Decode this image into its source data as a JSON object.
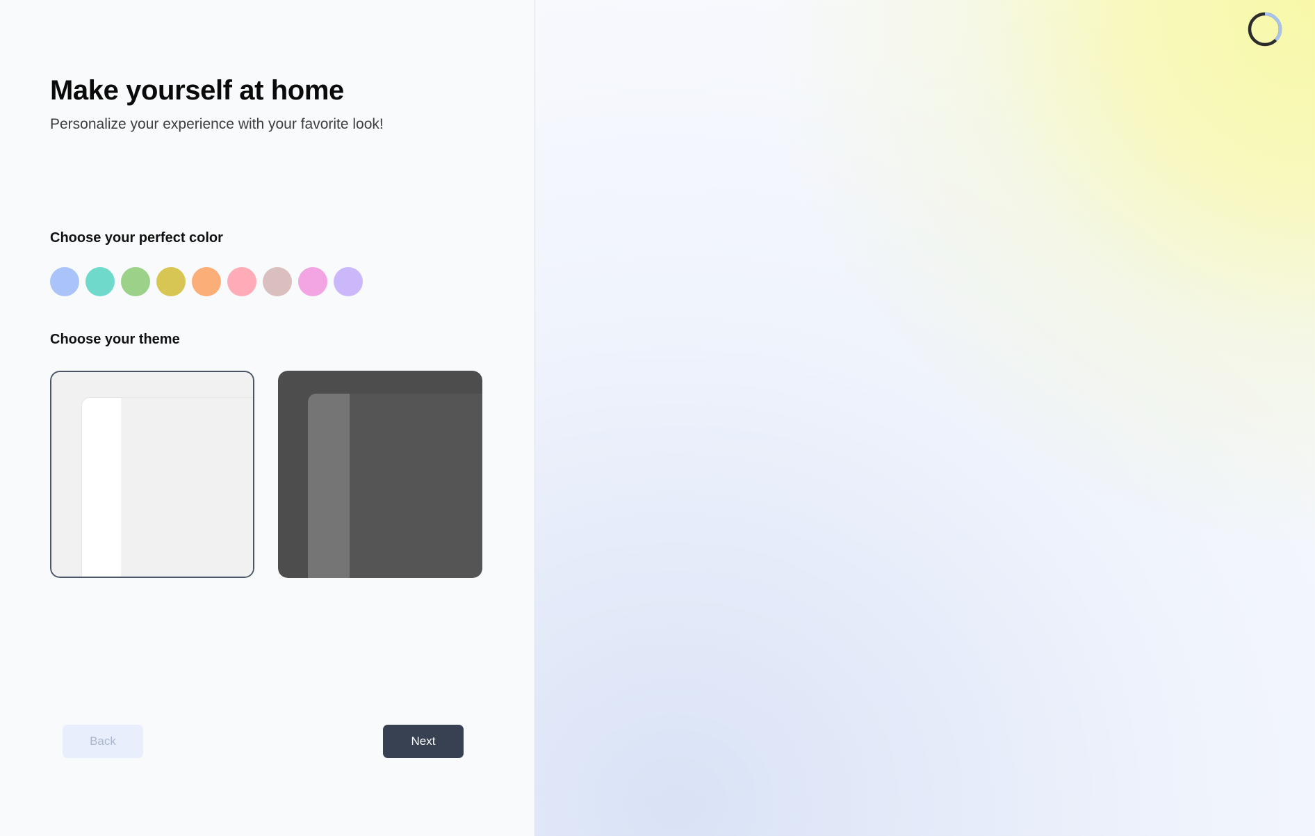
{
  "page": {
    "title": "Make yourself at home",
    "subtitle": "Personalize your experience with your favorite look!"
  },
  "sections": {
    "color_label": "Choose your perfect color",
    "theme_label": "Choose your theme"
  },
  "colors": {
    "selected_index": null,
    "swatches": [
      {
        "name": "blue",
        "hex": "#aac4fa"
      },
      {
        "name": "teal",
        "hex": "#6fd9cb"
      },
      {
        "name": "green",
        "hex": "#9bd189"
      },
      {
        "name": "yellow",
        "hex": "#d8c654"
      },
      {
        "name": "orange",
        "hex": "#fcae79"
      },
      {
        "name": "pink",
        "hex": "#ffabb8"
      },
      {
        "name": "rose",
        "hex": "#d9bfbe"
      },
      {
        "name": "magenta",
        "hex": "#f3a5e3"
      },
      {
        "name": "lavender",
        "hex": "#cbb8fb"
      }
    ]
  },
  "themes": {
    "selected": "light",
    "options": [
      {
        "id": "light",
        "selected": true,
        "surface": "#f1f1f1",
        "window": "#f1f1f1",
        "sidebar": "#ffffff"
      },
      {
        "id": "dark",
        "selected": false,
        "surface": "#4d4d4d",
        "window": "#555555",
        "sidebar": "#757575"
      }
    ],
    "selection_border": "#4a5568"
  },
  "footer": {
    "back_label": "Back",
    "back_disabled": true,
    "next_label": "Next",
    "next_color": "#374151",
    "back_color": "#e8eefb"
  },
  "right_panel": {
    "spinner": {
      "icon": "loading-spinner-icon",
      "track_color": "#2b2b2b",
      "arc_color": "#a8c4f0"
    },
    "gradient_from": "#fafaa0",
    "gradient_to": "#dbe4f7"
  }
}
